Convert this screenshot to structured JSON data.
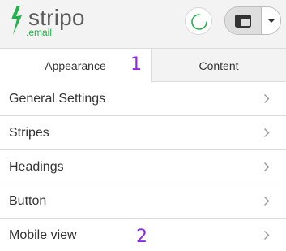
{
  "logo": {
    "word": "stripo",
    "sub": ".email",
    "icon": "stripo-bolt-icon"
  },
  "header": {
    "loading_icon": "loading-spinner-icon",
    "view_icon": "panel-layout-icon",
    "menu_icon": "chevron-down-icon"
  },
  "tabs": [
    {
      "label": "Appearance",
      "active": true
    },
    {
      "label": "Content",
      "active": false
    }
  ],
  "annotations": {
    "first": "1",
    "second": "2"
  },
  "settings": [
    {
      "label": "General Settings"
    },
    {
      "label": "Stripes"
    },
    {
      "label": "Headings"
    },
    {
      "label": "Button"
    },
    {
      "label": "Mobile view"
    }
  ],
  "colors": {
    "brand_green": "#21b24b",
    "annotation": "#8a2be2",
    "header_bg": "#f3f3f3"
  }
}
